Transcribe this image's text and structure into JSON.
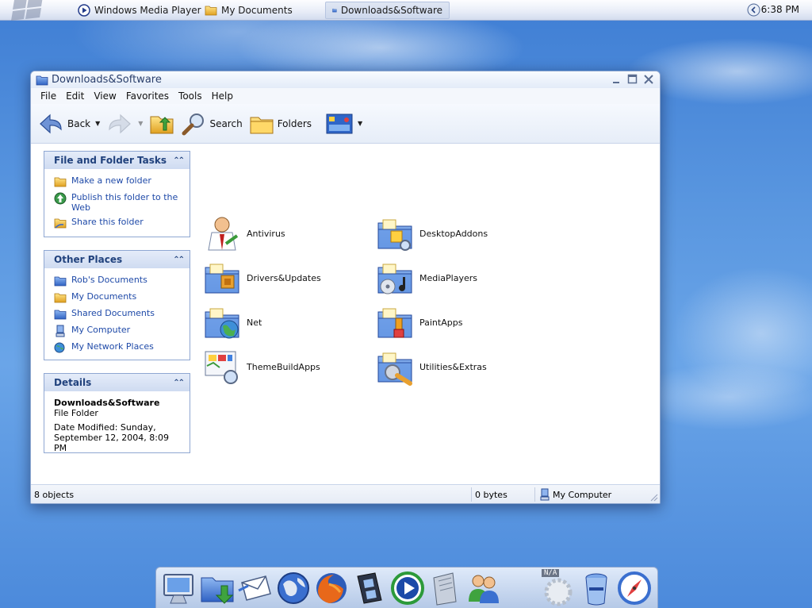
{
  "taskbar": {
    "tasks": [
      {
        "label": "Windows Media Player",
        "icon": "media-player-icon"
      },
      {
        "label": "My Documents",
        "icon": "my-documents-icon"
      },
      {
        "label": "Downloads&Software",
        "icon": "folder-icon",
        "active": true
      }
    ],
    "clock": "6:38 PM"
  },
  "window": {
    "title": "Downloads&Software",
    "menu": [
      "File",
      "Edit",
      "View",
      "Favorites",
      "Tools",
      "Help"
    ],
    "toolbar": {
      "back_label": "Back",
      "search_label": "Search",
      "folders_label": "Folders"
    },
    "panels": {
      "file_tasks": {
        "title": "File and Folder Tasks",
        "items": [
          {
            "label": "Make a new folder",
            "icon": "new-folder-icon"
          },
          {
            "label": "Publish this folder to the Web",
            "icon": "publish-web-icon"
          },
          {
            "label": "Share this folder",
            "icon": "share-folder-icon"
          }
        ]
      },
      "other_places": {
        "title": "Other Places",
        "items": [
          {
            "label": "Rob's Documents",
            "icon": "folder-icon"
          },
          {
            "label": "My Documents",
            "icon": "my-documents-icon"
          },
          {
            "label": "Shared Documents",
            "icon": "folder-icon"
          },
          {
            "label": "My Computer",
            "icon": "computer-icon"
          },
          {
            "label": "My Network Places",
            "icon": "network-places-icon"
          }
        ]
      },
      "details": {
        "title": "Details",
        "name": "Downloads&Software",
        "type": "File Folder",
        "modified_line1": "Date Modified: Sunday,",
        "modified_line2": "September 12, 2004, 8:09 PM"
      }
    },
    "files": [
      {
        "label": "Antivirus",
        "icon": "antivirus-folder-icon"
      },
      {
        "label": "DesktopAddons",
        "icon": "desktop-addons-folder-icon"
      },
      {
        "label": "Drivers&Updates",
        "icon": "drivers-folder-icon"
      },
      {
        "label": "MediaPlayers",
        "icon": "media-players-folder-icon"
      },
      {
        "label": "Net",
        "icon": "net-folder-icon"
      },
      {
        "label": "PaintApps",
        "icon": "paint-apps-folder-icon"
      },
      {
        "label": "ThemeBuildApps",
        "icon": "theme-build-folder-icon"
      },
      {
        "label": "Utilities&Extras",
        "icon": "utilities-folder-icon"
      }
    ],
    "status": {
      "objects": "8 objects",
      "size": "0 bytes",
      "location": "My Computer"
    }
  },
  "dock": {
    "icons": [
      "monitor-icon",
      "download-folder-icon",
      "mail-icon",
      "globe-icon",
      "firefox-icon",
      "film-icon",
      "media-player-icon",
      "document-icon",
      "users-icon",
      "gear-icon",
      "trash-icon",
      "compass-icon"
    ],
    "badge": "N/A"
  },
  "colors": {
    "accent": "#21427d",
    "link": "#1f4aa8",
    "folder": "#5b8fe0"
  }
}
